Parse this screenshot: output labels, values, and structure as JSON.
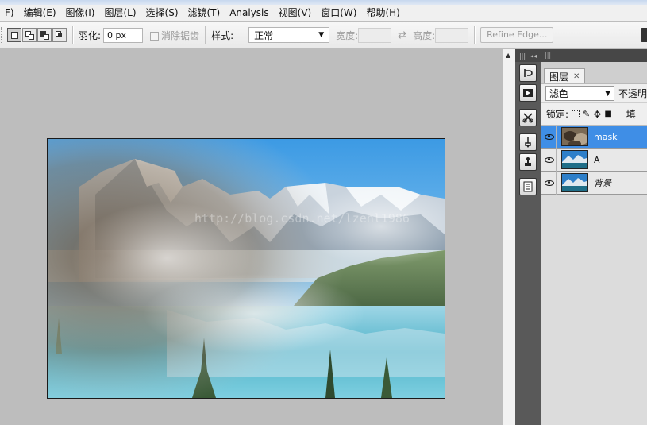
{
  "menu": [
    "F)",
    "编辑(E)",
    "图像(I)",
    "图层(L)",
    "选择(S)",
    "滤镜(T)",
    "Analysis",
    "视图(V)",
    "窗口(W)",
    "帮助(H)"
  ],
  "options": {
    "feather_label": "羽化:",
    "feather_value": "0 px",
    "antialias_label": "消除锯齿",
    "style_label": "样式:",
    "style_value": "正常",
    "width_label": "宽度:",
    "height_label": "高度:",
    "refine_edge_label": "Refine Edge..."
  },
  "canvas": {
    "watermark": "http://blog.csdn.net/lzenl1986"
  },
  "layers_panel": {
    "tab_label": "图层",
    "blend_mode": "滤色",
    "opacity_label": "不透明",
    "lock_label": "锁定:",
    "fill_label": "填",
    "layers": [
      {
        "name": "mask",
        "selected": true,
        "visible": true
      },
      {
        "name": "A",
        "selected": false,
        "visible": true
      },
      {
        "name": "背景",
        "selected": false,
        "visible": true
      }
    ]
  },
  "colors": {
    "selected_layer": "#3f8ee6",
    "canvas_bg": "#bdbdbd",
    "dock_bg": "#595959"
  }
}
